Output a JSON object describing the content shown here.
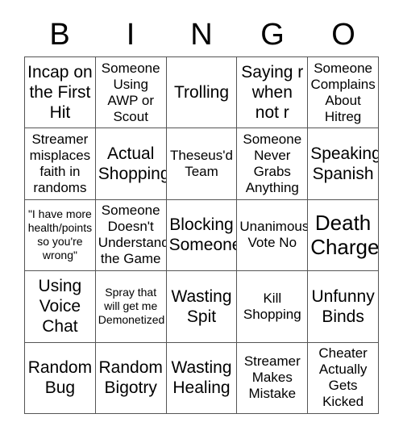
{
  "header": {
    "letters": [
      "B",
      "I",
      "N",
      "G",
      "O"
    ]
  },
  "grid": {
    "rows": 5,
    "columns": 5,
    "border_color": "#555555",
    "background_color": "#ffffff",
    "text_color": "#000000",
    "cells": [
      {
        "text": "Incap on the First Hit",
        "size": "lg"
      },
      {
        "text": "Someone Using AWP or Scout",
        "size": "md"
      },
      {
        "text": "Trolling",
        "size": "lg"
      },
      {
        "text": "Saying r when not r",
        "size": "lg"
      },
      {
        "text": "Someone Complains About Hitreg",
        "size": "md"
      },
      {
        "text": "Streamer misplaces faith in randoms",
        "size": "md"
      },
      {
        "text": "Actual Shopping",
        "size": "lg"
      },
      {
        "text": "Theseus'd Team",
        "size": "md"
      },
      {
        "text": "Someone Never Grabs Anything",
        "size": "md"
      },
      {
        "text": "Speaking Spanish",
        "size": "lg"
      },
      {
        "text": "\"I have more health/points so you're wrong\"",
        "size": "sm"
      },
      {
        "text": "Someone Doesn't Understand the Game",
        "size": "md"
      },
      {
        "text": "Blocking Someone",
        "size": "lg"
      },
      {
        "text": "Unanimous Vote No",
        "size": "md"
      },
      {
        "text": "Death Charge",
        "size": "xl"
      },
      {
        "text": "Using Voice Chat",
        "size": "lg"
      },
      {
        "text": "Spray that will get me Demonetized",
        "size": "sm"
      },
      {
        "text": "Wasting Spit",
        "size": "lg"
      },
      {
        "text": "Kill Shopping",
        "size": "md"
      },
      {
        "text": "Unfunny Binds",
        "size": "lg"
      },
      {
        "text": "Random Bug",
        "size": "lg"
      },
      {
        "text": "Random Bigotry",
        "size": "lg"
      },
      {
        "text": "Wasting Healing",
        "size": "lg"
      },
      {
        "text": "Streamer Makes Mistake",
        "size": "md"
      },
      {
        "text": "Cheater Actually Gets Kicked",
        "size": "md"
      }
    ]
  }
}
